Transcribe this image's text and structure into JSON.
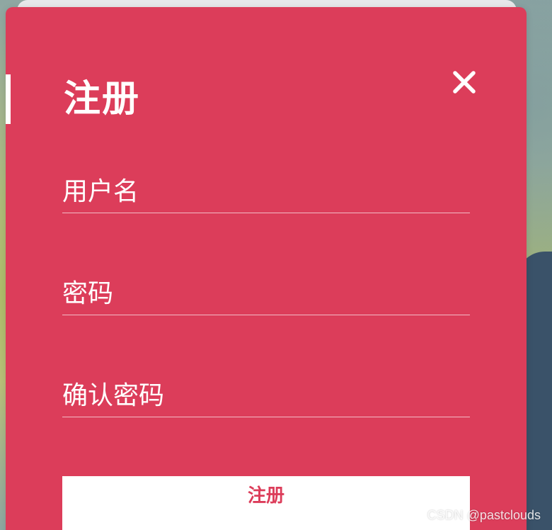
{
  "form": {
    "title": "注册",
    "close_icon": "close-icon",
    "fields": [
      {
        "name": "username",
        "placeholder": "用户名",
        "value": ""
      },
      {
        "name": "password",
        "placeholder": "密码",
        "value": ""
      },
      {
        "name": "confirm_password",
        "placeholder": "确认密码",
        "value": ""
      }
    ],
    "submit_label": "注册"
  },
  "watermark": "CSDN @pastclouds",
  "colors": {
    "panel": "#dc3d5a",
    "text": "#ffffff",
    "button_bg": "#ffffff",
    "button_text": "#dc3d5a"
  }
}
